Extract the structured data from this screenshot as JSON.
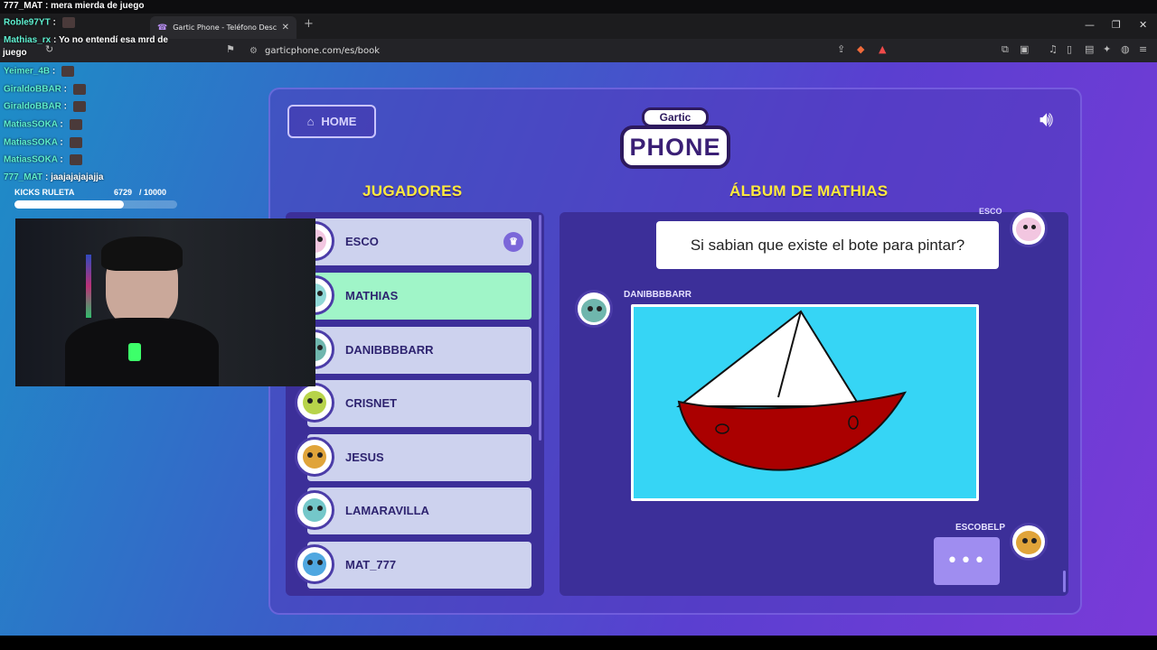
{
  "browser": {
    "tab_title": "Gartic Phone - Teléfono Descom…",
    "url": "garticphone.com/es/book"
  },
  "game": {
    "home_label": "HOME",
    "logo_top": "Gartic",
    "logo_main": "PHONE",
    "players_title": "JUGADORES",
    "album_title": "ÁLBUM DE MATHIAS",
    "players": [
      {
        "name": "ESCO",
        "host": true,
        "active": false,
        "avatar_color": "#f2c6e0"
      },
      {
        "name": "MATHIAS",
        "host": false,
        "active": true,
        "avatar_color": "#8fd7d6"
      },
      {
        "name": "DANIBBBBARR",
        "host": false,
        "active": false,
        "avatar_color": "#6fb6ad"
      },
      {
        "name": "CRISNET",
        "host": false,
        "active": false,
        "avatar_color": "#b7d34a"
      },
      {
        "name": "JESUS",
        "host": false,
        "active": false,
        "avatar_color": "#e0a43a"
      },
      {
        "name": "LAMARAVILLA",
        "host": false,
        "active": false,
        "avatar_color": "#74c7c9"
      },
      {
        "name": "MAT_777",
        "host": false,
        "active": false,
        "avatar_color": "#4fa7e0"
      }
    ],
    "album": {
      "top_author": "ESCO",
      "phrase": "Si sabian que existe el bote para pintar?",
      "drawing_author": "DANIBBBBARR",
      "next_author": "ESCOBELP",
      "typing": "•••"
    }
  },
  "overlay": {
    "top_message": {
      "user": "777_MAT",
      "text": "mera mierda de juego"
    },
    "chat": [
      {
        "user": "Roble97YT",
        "text": ""
      },
      {
        "user": "Mathias_rx",
        "text": "Yo no entendí esa mrd de"
      },
      {
        "user": "",
        "text": "juego"
      },
      {
        "user": "Yeimer_4B",
        "text": ""
      },
      {
        "user": "GiraldoBBAR",
        "text": ""
      },
      {
        "user": "GiraldoBBAR",
        "text": ""
      },
      {
        "user": "MatiasSOKA",
        "text": ""
      },
      {
        "user": "MatiasSOKA",
        "text": ""
      },
      {
        "user": "MatiasSOKA",
        "text": ""
      },
      {
        "user": "777_MAT",
        "text": "jaajajajajajja"
      }
    ],
    "kicks": {
      "label": "KICKS RULETA",
      "current": "6729",
      "goal": "/ 10000",
      "progress": 0.6729
    }
  }
}
